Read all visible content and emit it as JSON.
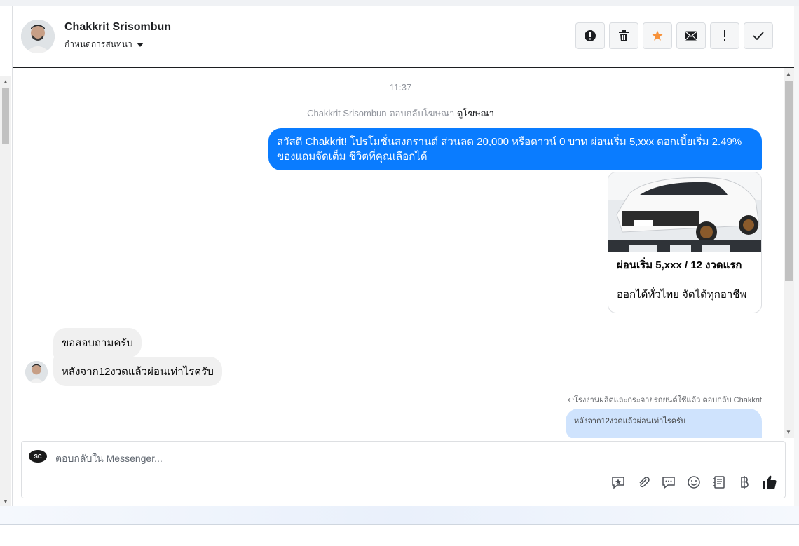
{
  "header": {
    "contact_name": "Chakkrit Srisombun",
    "assign_label": "กำหนดการสนทนา",
    "actions": [
      {
        "name": "report-spam-button",
        "icon": "alert-circle-icon"
      },
      {
        "name": "delete-button",
        "icon": "trash-icon"
      },
      {
        "name": "star-button",
        "icon": "star-icon"
      },
      {
        "name": "mark-unread-button",
        "icon": "envelope-icon"
      },
      {
        "name": "follow-up-button",
        "icon": "exclamation-icon"
      },
      {
        "name": "mark-done-button",
        "icon": "check-icon"
      }
    ],
    "star_color": "#f7923a"
  },
  "thread": {
    "timestamp": "11:37",
    "ad_note_prefix": "Chakkrit Srisombun ตอบกลับโฆษณา",
    "ad_note_link": "ดูโฆษณา",
    "outgoing_message": "สวัสดี Chakkrit! โปรโมชั่นสงกรานต์ ส่วนลด 20,000 หรือดาวน์ 0 บาท ผ่อนเริ่ม 5,xxx ดอกเบี้ยเริ่ม 2.49% ของแถมจัดเต็ม ชีวิตที่คุณเลือกได้",
    "outgoing_color": "#0a7cff",
    "card": {
      "title": "ผ่อนเริ่ม 5,xxx / 12 งวดแรก",
      "subtitle": "ออกได้ทั่วไทย จัดได้ทุกอาชีพ"
    },
    "incoming_messages": [
      "ขอสอบถามครับ",
      "หลังจาก12งวดแล้วผ่อนเท่าไรครับ"
    ],
    "reply_note": "↩โรงงานผลิตและกระจายรถยนต์ใช้แล้ว ตอบกลับ Chakkrit",
    "reply_quote": "หลังจาก12งวดแล้วผ่อนเท่าไรครับ"
  },
  "composer": {
    "placeholder": "ตอบกลับใน Messenger...",
    "page_logo_text": "SC",
    "tools": [
      {
        "name": "saved-reply-button",
        "icon": "chat-star-icon",
        "glyph": "✩"
      },
      {
        "name": "attach-button",
        "icon": "paperclip-icon",
        "glyph": "📎"
      },
      {
        "name": "quick-reply-button",
        "icon": "chat-bubble-icon",
        "glyph": "💬"
      },
      {
        "name": "emoji-button",
        "icon": "smiley-icon",
        "glyph": "☺"
      },
      {
        "name": "appointments-button",
        "icon": "notes-icon",
        "glyph": "▤"
      },
      {
        "name": "payment-button",
        "icon": "baht-icon",
        "glyph": "฿"
      },
      {
        "name": "like-button",
        "icon": "thumbs-up-icon",
        "glyph": "👍"
      }
    ]
  }
}
